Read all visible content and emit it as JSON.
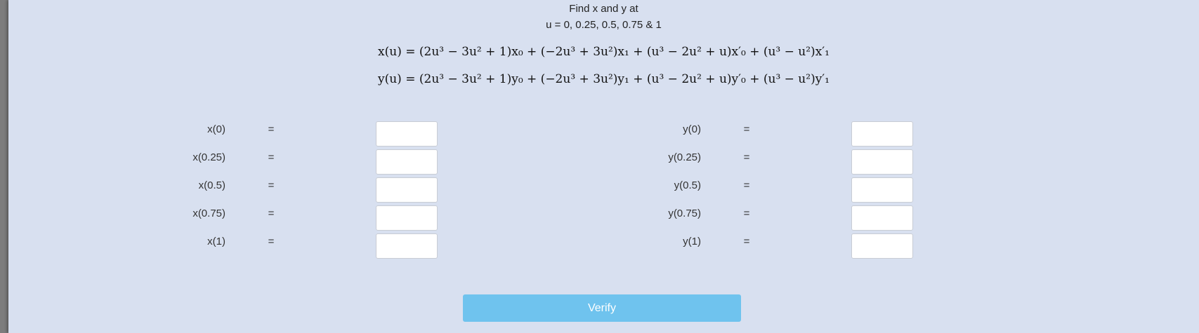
{
  "header": {
    "line1": "Find x and y at",
    "line2": "u = 0, 0.25, 0.5, 0.75 & 1"
  },
  "formulas": {
    "x": "x(u) = (2u³ − 3u² + 1)x₀ + (−2u³ + 3u²)x₁ + (u³ − 2u² + u)x′₀ + (u³ − u²)x′₁",
    "y": "y(u) = (2u³ − 3u² + 1)y₀ + (−2u³ + 3u²)y₁ + (u³ − 2u² + u)y′₀ + (u³ − u²)y′₁"
  },
  "equals_sign": "=",
  "x_rows": [
    {
      "label": "x(0)",
      "value": ""
    },
    {
      "label": "x(0.25)",
      "value": ""
    },
    {
      "label": "x(0.5)",
      "value": ""
    },
    {
      "label": "x(0.75)",
      "value": ""
    },
    {
      "label": "x(1)",
      "value": ""
    }
  ],
  "y_rows": [
    {
      "label": "y(0)",
      "value": ""
    },
    {
      "label": "y(0.25)",
      "value": ""
    },
    {
      "label": "y(0.5)",
      "value": ""
    },
    {
      "label": "y(0.75)",
      "value": ""
    },
    {
      "label": "y(1)",
      "value": ""
    }
  ],
  "verify_label": "Verify",
  "colors": {
    "background": "#d8e0f0",
    "button": "#6fc3ee",
    "input_border": "#c8ccd4"
  }
}
